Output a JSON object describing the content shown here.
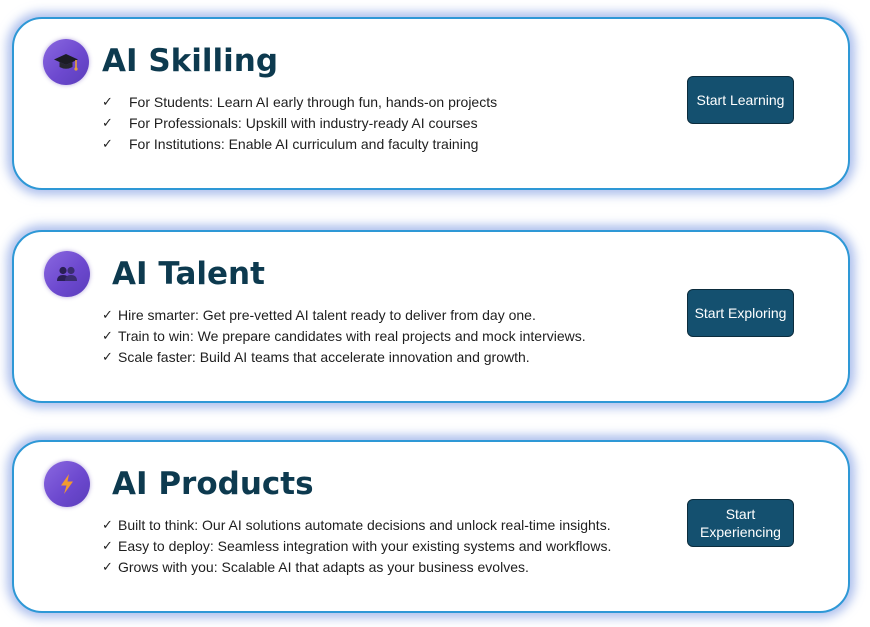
{
  "colors": {
    "card_border": "#2e98d6",
    "card_glow": "#7896e1",
    "title_text": "#0d3a4f",
    "button_bg": "#14506f",
    "button_text": "#ffffff",
    "icon_gradient_start": "#8a68e0",
    "icon_gradient_end": "#5a3dbb"
  },
  "cards": [
    {
      "icon": "graduation-cap-icon",
      "title": "AI Skilling",
      "check_mark": "✓",
      "bullets": [
        "For Students: Learn AI early through fun, hands-on projects",
        "For Professionals: Upskill with industry-ready AI courses",
        "For Institutions: Enable AI curriculum and faculty training"
      ],
      "button_label": "Start Learning"
    },
    {
      "icon": "people-icon",
      "title": "AI Talent",
      "check_mark": "✓",
      "bullets": [
        "Hire smarter: Get pre-vetted AI talent ready to deliver from day one.",
        "Train to win: We prepare candidates with real projects and mock interviews.",
        "Scale faster: Build AI teams that accelerate innovation and growth."
      ],
      "button_label": "Start Exploring"
    },
    {
      "icon": "lightning-bolt-icon",
      "title": "AI Products",
      "check_mark": "✓",
      "bullets": [
        "Built to think: Our AI solutions automate decisions and unlock real-time insights.",
        "Easy to deploy: Seamless integration with your existing systems and workflows.",
        "Grows with you: Scalable AI that adapts as your business evolves."
      ],
      "button_label": "Start Experiencing"
    }
  ]
}
